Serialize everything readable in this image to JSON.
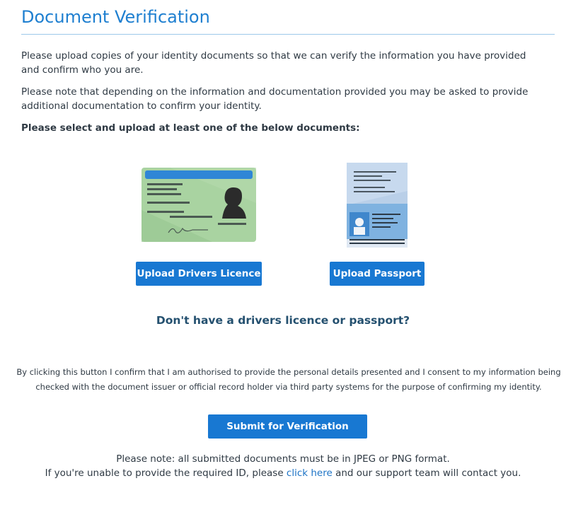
{
  "page": {
    "title": "Document Verification",
    "intro": "Please upload copies of your identity documents so that we can verify the information you have provided and confirm who you are.",
    "note_additional": "Please note that depending on the information and documentation provided you may be asked to provide additional documentation to confirm your identity.",
    "select_prompt": "Please select and upload at least one of the below documents:"
  },
  "documents": {
    "licence_button": "Upload Drivers Licence",
    "passport_button": "Upload Passport",
    "licence_icon": "drivers-licence-card-icon",
    "passport_icon": "passport-icon"
  },
  "no_docs_heading": "Don't have a drivers licence or passport?",
  "consent_text": "By clicking this button I confirm that I am authorised to provide the personal details presented and I consent to my information being checked with the document issuer or official record holder via third party systems for the purpose of confirming my identity.",
  "submit_button": "Submit for Verification",
  "footer": {
    "format_note": "Please note: all submitted documents must be in JPEG or PNG format.",
    "help_prefix": "If you're unable to provide the required ID, please ",
    "help_link": "click here",
    "help_suffix": " and our support team will contact you."
  },
  "colors": {
    "accent": "#1878d2",
    "title": "#1e7fd0",
    "heading": "#24506f",
    "text": "#2f3a44",
    "link": "#1e74c6"
  }
}
